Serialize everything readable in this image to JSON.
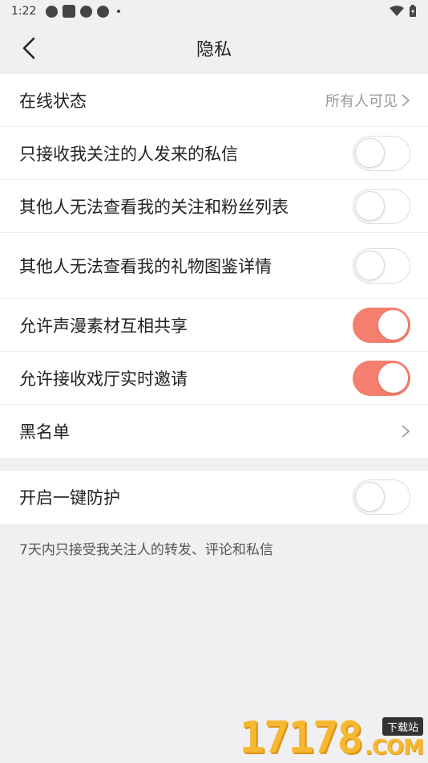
{
  "status_bar": {
    "time": "1:22"
  },
  "header": {
    "title": "隐私"
  },
  "settings": {
    "online_status": {
      "label": "在线状态",
      "value": "所有人可见"
    },
    "items": [
      {
        "label": "只接收我关注的人发来的私信",
        "enabled": false
      },
      {
        "label": "其他人无法查看我的关注和粉丝列表",
        "enabled": false
      },
      {
        "label": "其他人无法查看我的礼物图鉴详情",
        "enabled": false
      },
      {
        "label": "允许声漫素材互相共享",
        "enabled": true
      },
      {
        "label": "允许接收戏厅实时邀请",
        "enabled": true
      }
    ],
    "blacklist": {
      "label": "黑名单"
    }
  },
  "protection": {
    "label": "开启一键防护",
    "enabled": false,
    "note": "7天内只接受我关注人的转发、评论和私信"
  },
  "watermark": {
    "number": "17178",
    "badge": "下载站",
    "domain": ".COM"
  },
  "colors": {
    "toggle_on": "#f57f6f",
    "background": "#f0f0f2"
  }
}
